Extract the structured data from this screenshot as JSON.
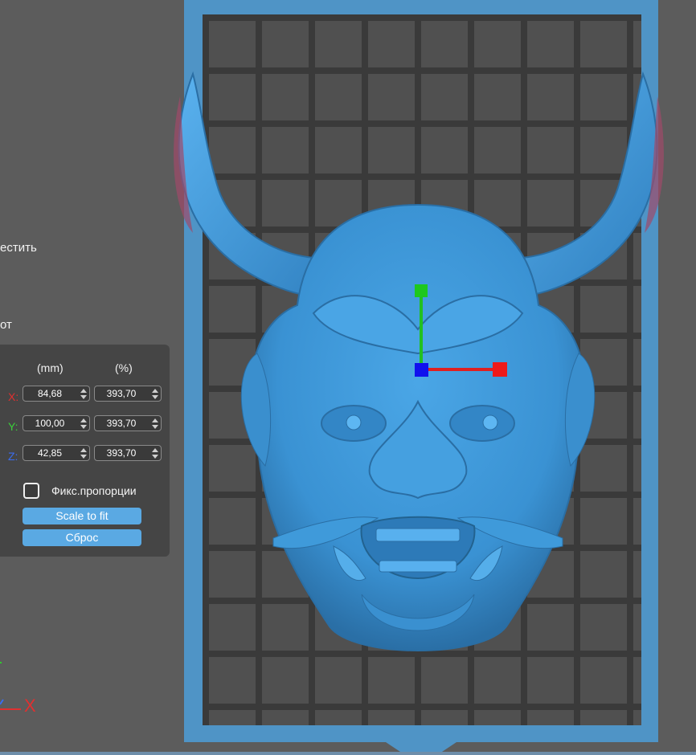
{
  "sidebar": {
    "cropped_text_1": "естить",
    "cropped_text_2": "от"
  },
  "scale_panel": {
    "col_mm": "(mm)",
    "col_percent": "(%)",
    "rows": [
      {
        "axis": "X",
        "axis_label": "X:",
        "mm": "84,68",
        "percent": "393,70",
        "color": "#e03030"
      },
      {
        "axis": "Y",
        "axis_label": "Y:",
        "mm": "100,00",
        "percent": "393,70",
        "color": "#3ad03a"
      },
      {
        "axis": "Z",
        "axis_label": "Z:",
        "mm": "42,85",
        "percent": "393,70",
        "color": "#3a6cf0"
      }
    ],
    "uniform_label": "Фикс.пропорции",
    "uniform_checked": false,
    "scale_to_fit_label": "Scale to fit",
    "reset_label": "Сброс"
  },
  "triad": {
    "x_label": "X"
  },
  "colors": {
    "plate_frame": "#4f94c6",
    "model": "#3c95d4",
    "button": "#5aa9e3"
  }
}
